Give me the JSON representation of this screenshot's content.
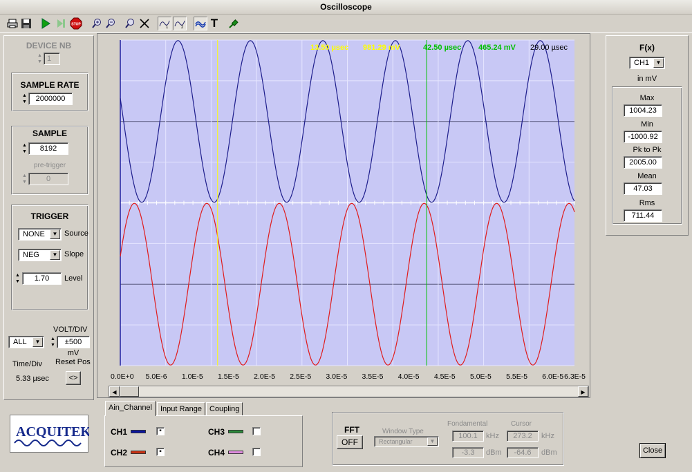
{
  "window": {
    "title": "Oscilloscope"
  },
  "toolbar": {
    "icons": [
      "print-icon",
      "save-icon",
      "play-icon",
      "step-icon",
      "stop-icon",
      "zoom-in-icon",
      "zoom-out-icon",
      "zoom-icon",
      "cursor-cross-icon",
      "channel-one-icon",
      "channel-two-icon",
      "waveform-icon",
      "text-icon",
      "probe-icon"
    ],
    "stop_text": "STOP",
    "text_tool": "T"
  },
  "device": {
    "label": "DEVICE NB",
    "value": "1"
  },
  "sample_rate": {
    "label": "SAMPLE RATE",
    "value": "2000000"
  },
  "sample": {
    "label": "SAMPLE",
    "value": "8192",
    "pretrigger_label": "pre-trigger",
    "pretrigger_value": "0"
  },
  "trigger": {
    "label": "TRIGGER",
    "source_value": "NONE",
    "source_label": "Source",
    "slope_value": "NEG",
    "slope_label": "Slope",
    "level_value": "1.70",
    "level_label": "Level"
  },
  "voltdiv": {
    "channel": "ALL",
    "label": "VOLT/DIV",
    "value": "±500 mV"
  },
  "timediv": {
    "label": "Time/Div",
    "value": "5.33 µsec",
    "reset_label": "Reset Pos",
    "reset_button": "<>"
  },
  "logo": {
    "text": "ACQUITEK"
  },
  "plot": {
    "cursor1": {
      "time": "13.50 µsec",
      "value": "981.29 mV",
      "color": "#ffff00"
    },
    "cursor2": {
      "time": "42.50 µsec",
      "value": "465.24 mV",
      "color": "#00c000"
    },
    "delta": "29.00 µsec",
    "bg_color": "#c8c8f5",
    "ch1_color": "#1e1e8c",
    "ch2_color": "#e01c1c",
    "x_ticks": [
      "0.0E+0",
      "5.0E-6",
      "1.0E-5",
      "1.5E-5",
      "2.0E-5",
      "2.5E-5",
      "3.0E-5",
      "3.5E-5",
      "4.0E-5",
      "4.5E-5",
      "5.0E-5",
      "5.5E-5",
      "6.0E-5",
      "6.3E-5"
    ]
  },
  "tabs": [
    "Ain_Channel",
    "Input Range",
    "Coupling"
  ],
  "channels": [
    {
      "name": "CH1",
      "color": "#0a14a0",
      "checked": true
    },
    {
      "name": "CH2",
      "color": "#c83214",
      "checked": true
    },
    {
      "name": "CH3",
      "color": "#2d8c3c",
      "checked": false
    },
    {
      "name": "CH4",
      "color": "#e08ce0",
      "checked": false
    }
  ],
  "fft": {
    "label": "FFT",
    "button": "OFF",
    "window_label": "Window Type",
    "window_value": "Rectangular",
    "fund_label": "Fondamental",
    "cursor_label": "Cursor",
    "fund_freq": "100.1",
    "fund_freq_unit": "kHz",
    "cursor_freq": "273.2",
    "cursor_freq_unit": "kHz",
    "fund_db": "-3.3",
    "fund_db_unit": "dBm",
    "cursor_db": "-64.6",
    "cursor_db_unit": "dBm"
  },
  "fx": {
    "label": "F(x)",
    "channel": "CH1",
    "unit": "in mV",
    "stats": [
      {
        "label": "Max",
        "value": "1004.23"
      },
      {
        "label": "Min",
        "value": "-1000.92"
      },
      {
        "label": "Pk to Pk",
        "value": "2005.00"
      },
      {
        "label": "Mean",
        "value": "47.03"
      },
      {
        "label": "Rms",
        "value": "711.44"
      }
    ]
  },
  "close_button": "Close"
}
